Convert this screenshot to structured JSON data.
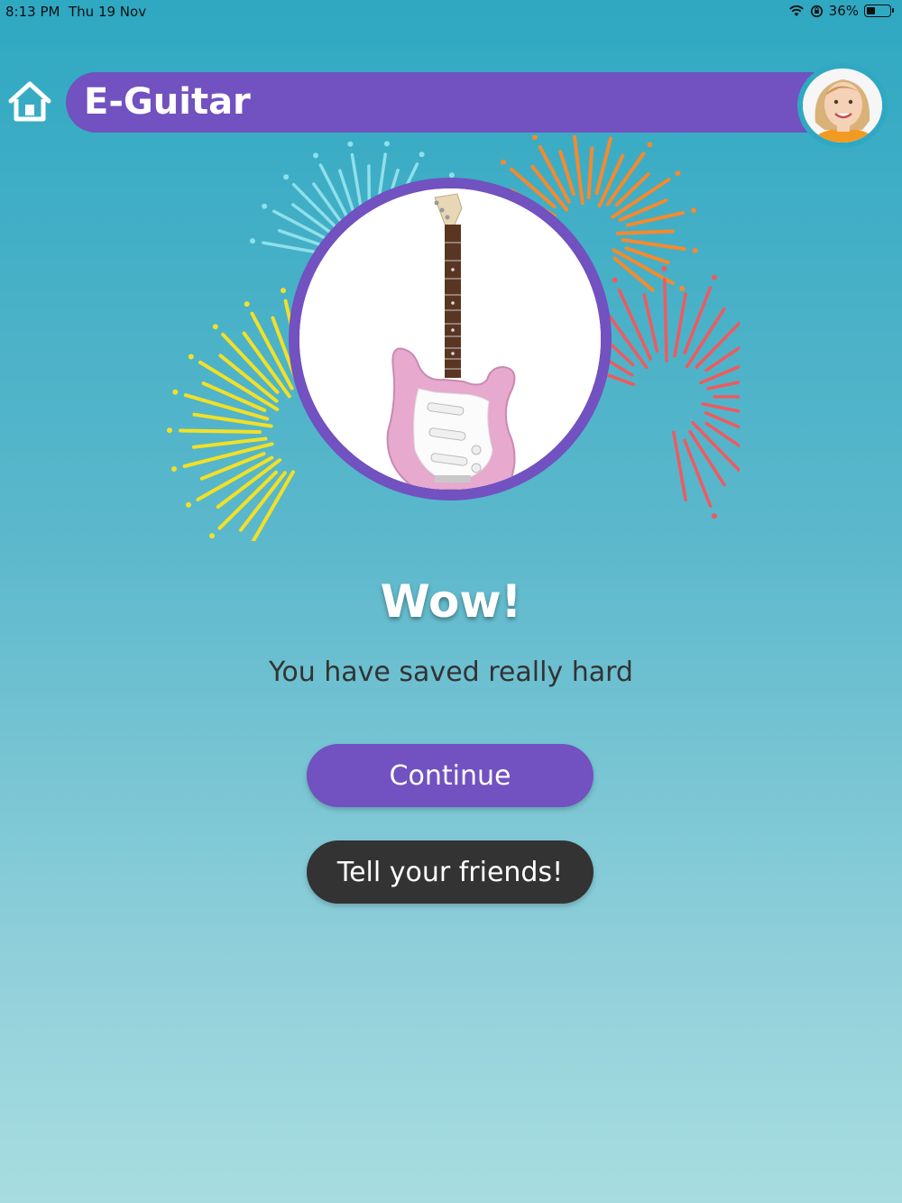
{
  "status_bar": {
    "time": "8:13 PM",
    "date": "Thu 19 Nov",
    "battery_text": "36%",
    "battery_level": 0.36,
    "icons": [
      "wifi-icon",
      "orientation-lock-icon",
      "battery-icon"
    ]
  },
  "header": {
    "title": "E-Guitar",
    "home_icon": "home-icon",
    "avatar": "child-avatar"
  },
  "main": {
    "item_image": "pink-electric-guitar",
    "decoration": "fireworks",
    "headline": "Wow!",
    "message": "You have saved really hard",
    "continue_label": "Continue",
    "share_label": "Tell your friends!"
  },
  "colors": {
    "accent": "#7251c0",
    "dark_button": "#333333",
    "background_top": "#2fa8c2",
    "background_bottom": "#a7dde0"
  }
}
